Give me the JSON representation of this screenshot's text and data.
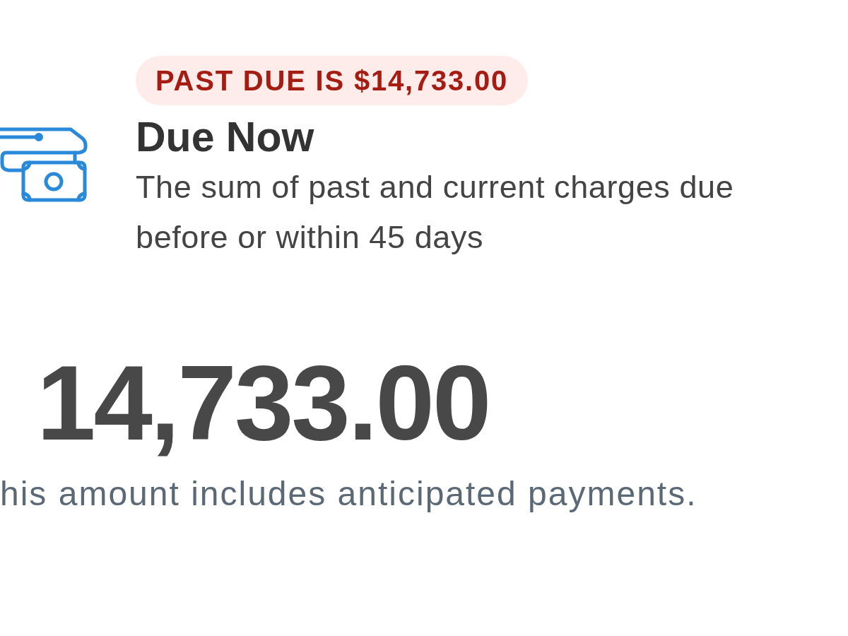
{
  "due_card": {
    "badge": "PAST DUE IS $14,733.00",
    "title": "Due Now",
    "description": "The sum of past and current charges due before or within 45 days",
    "amount": "14,733.00",
    "note": "his amount includes anticipated payments."
  }
}
